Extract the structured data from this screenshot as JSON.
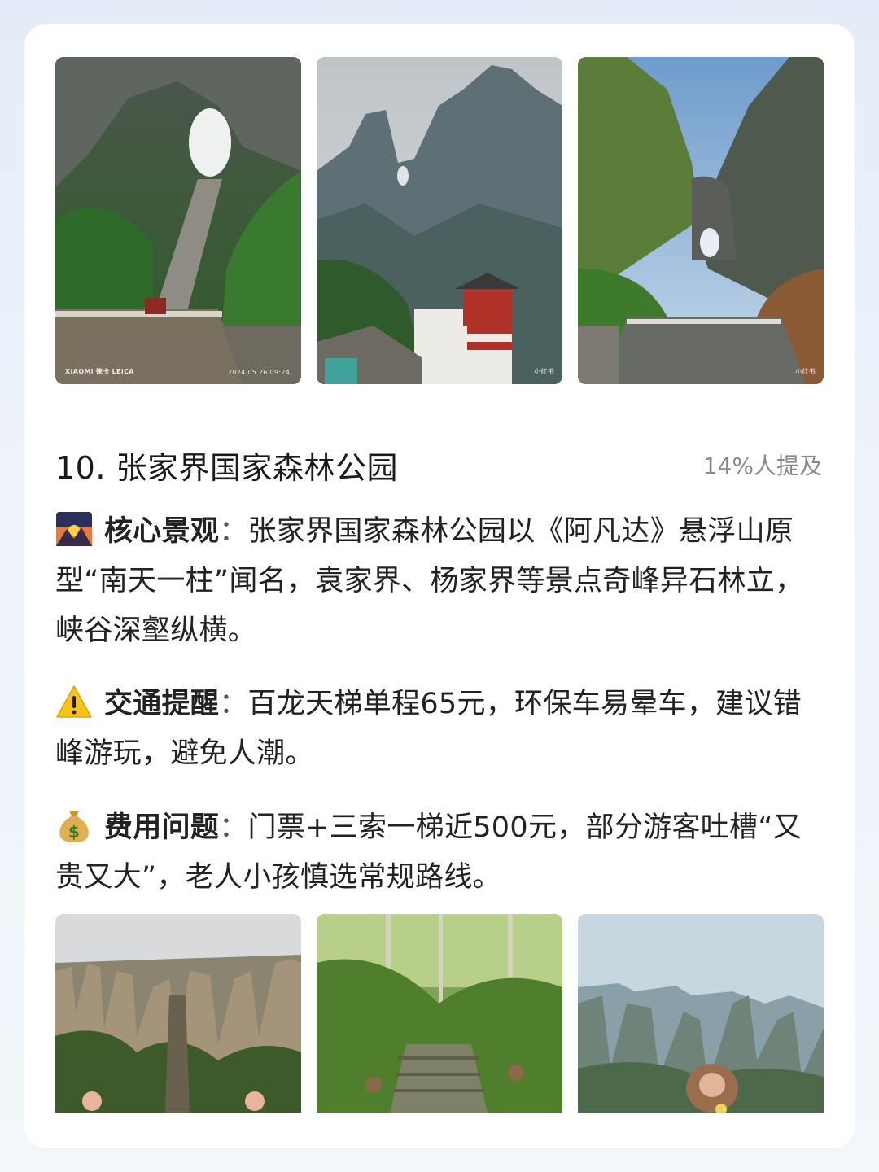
{
  "header": {
    "title": "10. 张家界国家森林公园",
    "mention": "14%人提及"
  },
  "photos_top": [
    {
      "icon": "tianmen-stairs-photo",
      "watermark_left": "XIAOMI 徕卡 LEICA",
      "watermark_right": "2024.05.26 09:24"
    },
    {
      "icon": "mountain-temple-photo",
      "watermark_right": "小红书"
    },
    {
      "icon": "tianmen-cave-photo",
      "watermark_right": "小红书"
    }
  ],
  "sections": [
    {
      "icon": "sunrise-mountain-icon",
      "label": "核心景观",
      "separator": "：",
      "text": "张家界国家森林公园以《阿凡达》悬浮山原型“南天一柱”闻名，袁家界、杨家界等景点奇峰异石林立，峡谷深壑纵横。"
    },
    {
      "icon": "warning-icon",
      "label": "交通提醒",
      "separator": "：",
      "text": "百龙天梯单程65元，环保车易晕车，建议错峰游玩，避免人潮。"
    },
    {
      "icon": "money-bag-icon",
      "label": "费用问题",
      "separator": "：",
      "text": "门票+三索一梯近500元，部分游客吐槽“又贵又大”，老人小孩慎选常规路线。"
    }
  ],
  "photos_bottom": [
    {
      "icon": "sandstone-peaks-photo"
    },
    {
      "icon": "forest-steps-monkeys-photo"
    },
    {
      "icon": "monkey-peaks-photo"
    }
  ],
  "colors": {
    "background": "#e7eef8",
    "card": "#ffffff",
    "text": "#222222",
    "muted": "#8a8a8a"
  }
}
